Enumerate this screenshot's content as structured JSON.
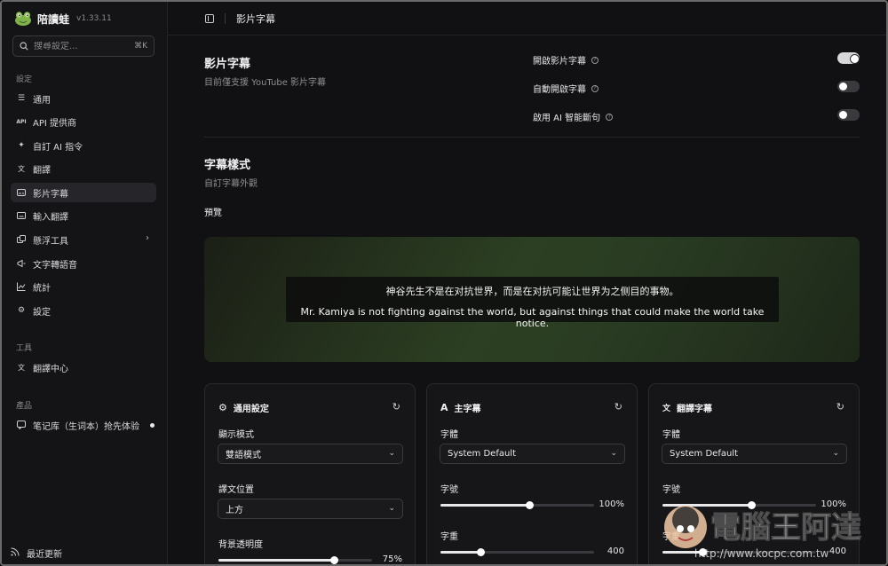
{
  "app": {
    "name": "陪讀蛙",
    "version": "v1.33.11"
  },
  "search": {
    "placeholder": "搜尋設定...",
    "shortcut": "⌘K"
  },
  "sidebar": {
    "section_settings": "設定",
    "items": [
      {
        "label": "通用",
        "icon": "sliders-icon"
      },
      {
        "label": "API 提供商",
        "icon": "api-icon"
      },
      {
        "label": "自訂 AI 指令",
        "icon": "sparkle-icon"
      },
      {
        "label": "翻譯",
        "icon": "translate-icon"
      },
      {
        "label": "影片字幕",
        "icon": "subtitle-icon"
      },
      {
        "label": "輸入翻譯",
        "icon": "keyboard-icon"
      },
      {
        "label": "懸浮工具",
        "icon": "floating-tool-icon"
      },
      {
        "label": "文字轉語音",
        "icon": "megaphone-icon"
      },
      {
        "label": "統計",
        "icon": "chart-icon"
      },
      {
        "label": "設定",
        "icon": "gear-icon"
      }
    ],
    "section_tools": "工具",
    "tools": [
      {
        "label": "翻譯中心",
        "icon": "translate-center-icon"
      }
    ],
    "section_products": "產品",
    "products": [
      {
        "label": "笔记库（生词本）抢先体验",
        "icon": "notebook-icon"
      }
    ],
    "footer_link": "最近更新"
  },
  "header": {
    "breadcrumb": "影片字幕"
  },
  "video_subtitles": {
    "title": "影片字幕",
    "subtitle": "目前僅支援 YouTube 影片字幕",
    "options": [
      {
        "label": "開啟影片字幕",
        "enabled": true
      },
      {
        "label": "自動開啟字幕",
        "enabled": false
      },
      {
        "label": "啟用 AI 智能斷句",
        "enabled": false
      }
    ]
  },
  "style": {
    "title": "字幕樣式",
    "subtitle": "自訂字幕外觀",
    "preview_label": "預覽",
    "preview_line1": "神谷先生不是在对抗世界，而是在对抗可能让世界为之侧目的事物。",
    "preview_line2": "Mr. Kamiya is not fighting against the world, but against things that could make the world take notice."
  },
  "cards": {
    "general": {
      "title": "通用設定",
      "display_mode_label": "顯示模式",
      "display_mode_value": "雙語模式",
      "position_label": "譯文位置",
      "position_value": "上方",
      "opacity_label": "背景透明度",
      "opacity_value": "75%",
      "opacity_fraction": 0.75
    },
    "main": {
      "title": "主字幕",
      "font_label": "字體",
      "font_value": "System Default",
      "size_label": "字號",
      "size_value": "100%",
      "size_fraction": 0.58,
      "weight_label": "字重",
      "weight_value": "400",
      "weight_fraction": 0.26
    },
    "translation": {
      "title": "翻譯字幕",
      "font_label": "字體",
      "font_value": "System Default",
      "size_label": "字號",
      "size_value": "100%",
      "size_fraction": 0.58,
      "weight_label": "字重",
      "weight_value": "400",
      "weight_fraction": 0.26
    }
  },
  "watermark": {
    "text": "電腦王阿達",
    "url": "http://www.kocpc.com.tw"
  }
}
